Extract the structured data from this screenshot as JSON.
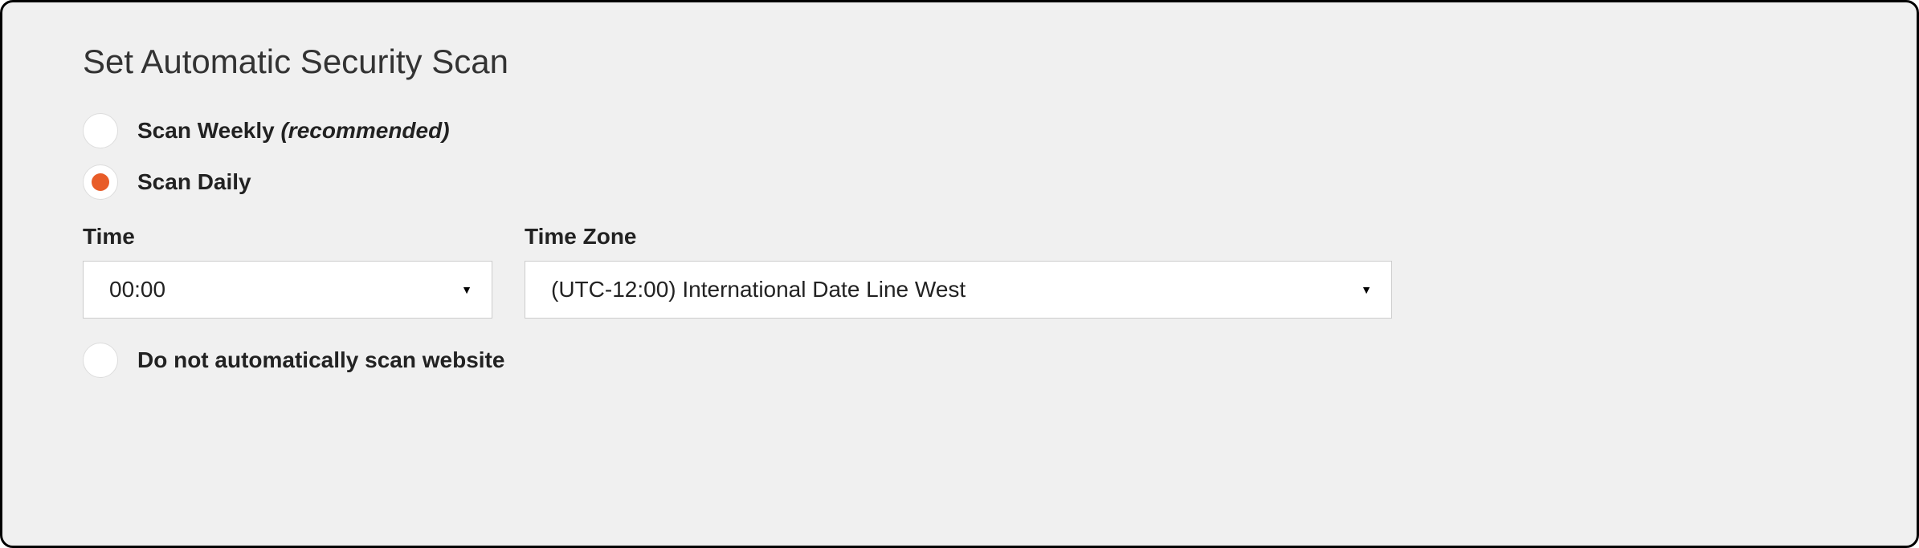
{
  "panel": {
    "title": "Set Automatic Security Scan",
    "options": {
      "weekly_label": "Scan Weekly ",
      "weekly_hint": "(recommended)",
      "daily_label": "Scan Daily",
      "none_label": "Do not automatically scan website"
    },
    "fields": {
      "time_label": "Time",
      "time_value": "00:00",
      "tz_label": "Time Zone",
      "tz_value": "(UTC-12:00) International Date Line West"
    },
    "selected": "daily",
    "colors": {
      "accent": "#e85c28"
    }
  }
}
